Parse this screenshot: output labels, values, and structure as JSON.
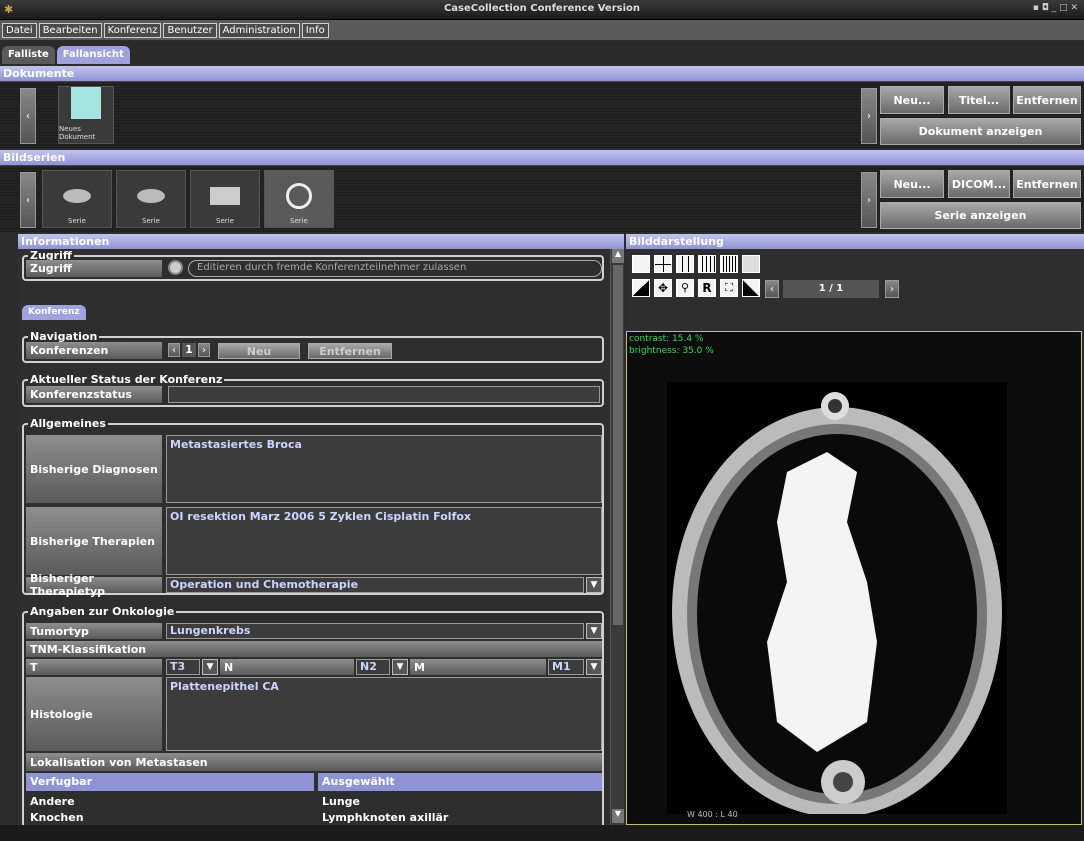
{
  "window": {
    "title": "CaseCollection Conference Version",
    "controls": "▪ ◘ _ □ ✕"
  },
  "menu": [
    "Datei",
    "Bearbeiten",
    "Konferenz",
    "Benutzer",
    "Administration",
    "Info"
  ],
  "tabs": [
    "Falliste",
    "Fallansicht"
  ],
  "dokumente": {
    "header": "Dokumente",
    "doc_label": "Neues Dokument",
    "btn_neu": "Neu...",
    "btn_titel": "Titel...",
    "btn_entfernen": "Entfernen",
    "btn_anzeigen": "Dokument anzeigen"
  },
  "bildserien": {
    "header": "Bildserien",
    "series": [
      "Serie",
      "Serie",
      "Serie",
      "Serie"
    ],
    "btn_neu": "Neu...",
    "btn_dicom": "DICOM...",
    "btn_entfernen": "Entfernen",
    "btn_anzeigen": "Serie anzeigen"
  },
  "info": {
    "header": "Informationen",
    "zugriff": {
      "group": "Zugriff",
      "label": "Zugriff",
      "option": "Editieren durch fremde Konferenzteilnehmer zulassen"
    },
    "konferenz_tab": "Konferenz",
    "navigation": {
      "group": "Navigation",
      "label": "Konferenzen",
      "page": "1",
      "btn_neu": "Neu",
      "btn_entfernen": "Entfernen"
    },
    "status": {
      "group": "Aktueller Status der Konferenz",
      "label": "Konferenzstatus",
      "value": ""
    },
    "allgemeines": {
      "group": "Allgemeines",
      "diag_label": "Bisherige Diagnosen",
      "diag_value": "Metastasiertes Broca",
      "ther_label": "Bisherige Therapien",
      "ther_value": "OI resektion Marz 2006 5 Zyklen Cisplatin Folfox",
      "typ_label": "Bisheriger Therapietyp",
      "typ_value": "Operation und Chemotherapie"
    },
    "onkologie": {
      "group": "Angaben zur Onkologie",
      "tumor_label": "Tumortyp",
      "tumor_value": "Lungenkrebs",
      "tnm_label": "TNM-Klassifikation",
      "t_label": "T",
      "t_value": "T3",
      "n_label": "N",
      "n_value": "N2",
      "m_label": "M",
      "m_value": "M1",
      "hist_label": "Histologie",
      "hist_value": "Plattenepithel CA",
      "meta_label": "Lokalisation von Metastasen",
      "verf_header": "Verfugbar",
      "ausg_header": "Ausgewählt",
      "verf_items": [
        "Andere",
        "Knochen"
      ],
      "ausg_items": [
        "Lunge",
        "Lymphknoten axillär"
      ]
    }
  },
  "viewer": {
    "header": "Bilddarstellung",
    "page": "1 / 1",
    "contrast": "contrast: 15.4 %",
    "brightness": "brightness: 35.0 %",
    "wl": "W 400 : L 40"
  }
}
